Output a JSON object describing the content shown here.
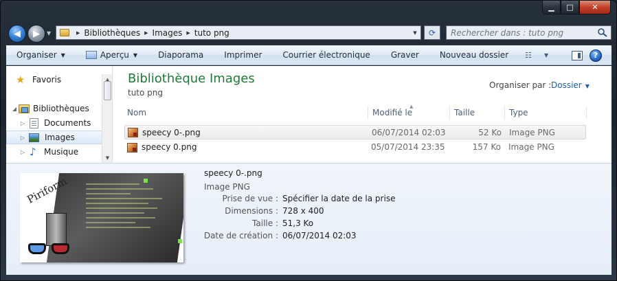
{
  "window": {
    "caption_min": "▁",
    "caption_max": "□",
    "caption_close": "✕"
  },
  "nav": {
    "breadcrumb": [
      "Bibliothèques",
      "Images",
      "tuto png"
    ],
    "search_placeholder": "Rechercher dans : tuto png"
  },
  "toolbar": {
    "organize": "Organiser",
    "preview": "Aperçu",
    "slideshow": "Diaporama",
    "print": "Imprimer",
    "email": "Courrier électronique",
    "burn": "Graver",
    "new_folder": "Nouveau dossier",
    "help": "?"
  },
  "sidebar": {
    "items": [
      {
        "label": "Favoris",
        "icon": "star-icon"
      },
      {
        "label": "Bibliothèques",
        "icon": "library-icon"
      },
      {
        "label": "Documents",
        "icon": "documents-icon"
      },
      {
        "label": "Images",
        "icon": "pictures-icon"
      },
      {
        "label": "Musique",
        "icon": "music-icon"
      }
    ]
  },
  "library": {
    "title": "Bibliothèque Images",
    "subtitle": "tuto png",
    "arrange_label": "Organiser par :",
    "arrange_value": "Dossier"
  },
  "columns": [
    "Nom",
    "Modifié le",
    "Taille",
    "Type"
  ],
  "files": [
    {
      "name": "speecy 0-.png",
      "modified": "06/07/2014 02:03",
      "size": "52 Ko",
      "type": "Image PNG",
      "selected": true
    },
    {
      "name": "speecy 0.png",
      "modified": "05/07/2014 23:35",
      "size": "157 Ko",
      "type": "Image PNG",
      "selected": false
    }
  ],
  "details": {
    "name": "speecy 0-.png",
    "type": "Image PNG",
    "thumb_logo": "Piriform",
    "props": [
      {
        "label": "Prise de vue :",
        "value": "Spécifier la date de la prise"
      },
      {
        "label": "Dimensions :",
        "value": "728 x 400"
      },
      {
        "label": "Taille :",
        "value": "51,3 Ko"
      },
      {
        "label": "Date de création :",
        "value": "06/07/2014 02:03"
      }
    ]
  },
  "colors": {
    "library_title": "#1e7a34",
    "link": "#1c5ea8"
  }
}
